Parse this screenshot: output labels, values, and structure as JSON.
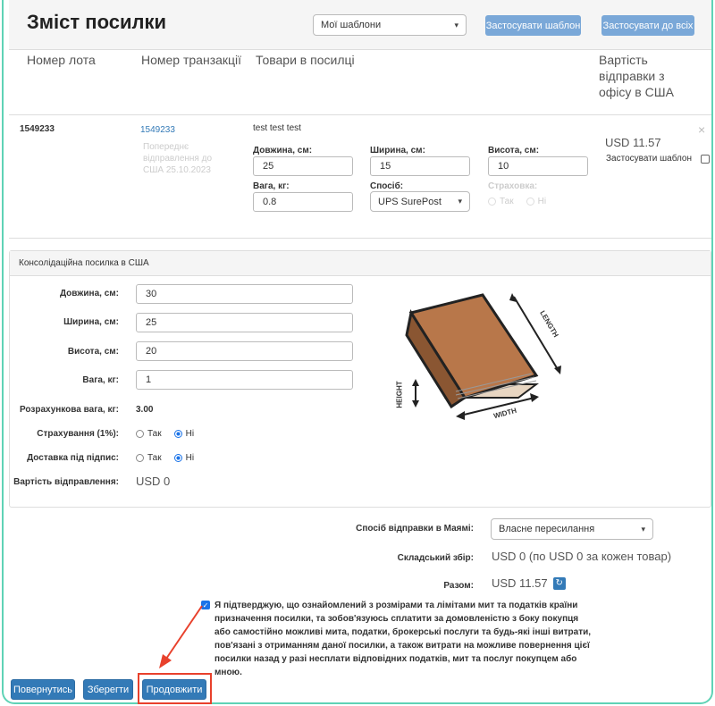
{
  "header": {
    "title": "Зміст посилки",
    "template_select": "Мої шаблони",
    "apply_template": "Застосувати шаблон",
    "apply_all": "Застосувати до всіх"
  },
  "columns": [
    "Номер лота",
    "Номер транзакції",
    "Товари в посилці",
    "Вартість відправки з офісу в США"
  ],
  "item": {
    "lot": "1549233",
    "transaction": "1549233",
    "goods": "test test test",
    "faded_info": "Попереднє відправлення до США 25.10.2023",
    "length_label": "Довжина, см:",
    "length": "25",
    "width_label": "Ширина, см:",
    "width": "15",
    "height_label": "Висота, см:",
    "height": "10",
    "weight_label": "Вага, кг:",
    "weight": "0.8",
    "method_label": "Спосіб:",
    "method": "UPS SurePost",
    "insurance_label": "Страховка:",
    "ins_yes": "Так",
    "ins_no": "Ні",
    "price": "USD 11.57",
    "apply_template_label": "Застосувати шаблон",
    "close": "×"
  },
  "consolidated": {
    "title": "Консолідаційна посилка в США",
    "length_label": "Довжина, см:",
    "length": "30",
    "width_label": "Ширина, см:",
    "width": "25",
    "height_label": "Висота, см:",
    "height": "20",
    "weight_label": "Вага, кг:",
    "weight": "1",
    "calc_weight_label": "Розрахункова вага, кг:",
    "calc_weight": "3.00",
    "insurance_label": "Страхування (1%):",
    "signature_label": "Доставка під підпис:",
    "yes": "Так",
    "no": "Ні",
    "cost_label": "Вартість відправлення:",
    "cost": "USD 0",
    "box_labels": {
      "length": "LENGTH",
      "width": "WIDTH",
      "height": "HEIGHT"
    }
  },
  "summary": {
    "method_label": "Спосіб відправки в Маямі:",
    "method": "Власне пересилання",
    "storage_label": "Складський збір:",
    "storage": "USD 0 (по USD 0 за кожен товар)",
    "total_label": "Разом:",
    "total": "USD 11.57"
  },
  "consent": "Я підтверджую, що ознайомлений з розмірами та лімітами мит та податків країни призначення посилки, та зобов'язуюсь сплатити за домовленістю з боку покупця або самостійно можливі мита, податки, брокерські послуги та будь-які інші витрати, пов'язані з отриманням даної посилки, а також витрати на можливе повернення цієї посилки назад у разі несплати відповідних податків, мит та послуг покупцем або мною.",
  "buttons": {
    "back": "Повернутись",
    "save": "Зберегти",
    "continue": "Продовжити"
  },
  "colors": {
    "primary": "#337ab7",
    "highlight": "#e8412c",
    "frame": "#5fd3b6",
    "box": "#b8774a"
  }
}
